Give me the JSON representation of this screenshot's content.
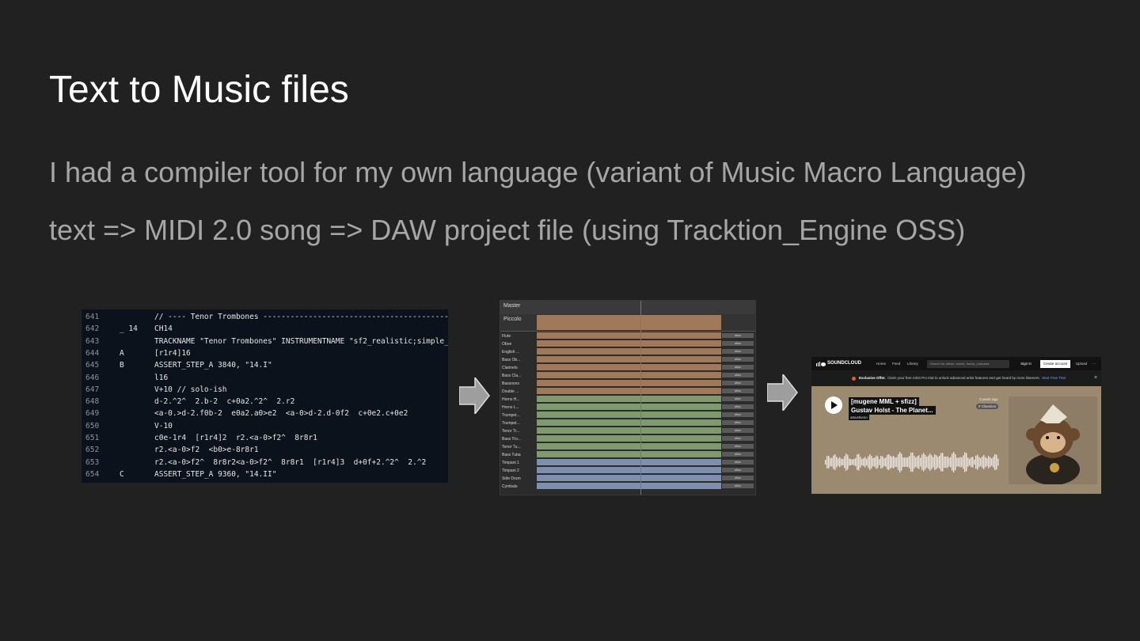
{
  "slide": {
    "title": "Text to Music files",
    "line1": "I had a compiler tool for my own language (variant of Music Macro Language)",
    "line2": "text => MIDI 2.0 song => DAW project file (using Tracktion_Engine OSS)"
  },
  "code": {
    "lines": [
      {
        "n": "641",
        "label": "",
        "text": "// ---- Tenor Trombones -----------------------------------------------------"
      },
      {
        "n": "642",
        "label": "_ 14",
        "text": "CH14"
      },
      {
        "n": "643",
        "label": "",
        "text": "TRACKNAME \"Tenor Trombones\" INSTRUMENTNAME \"sf2_realistic;simple_re"
      },
      {
        "n": "644",
        "label": "A",
        "text": "[r1r4]16"
      },
      {
        "n": "645",
        "label": "B",
        "text": "ASSERT_STEP_A 3840, \"14.I\""
      },
      {
        "n": "646",
        "label": "",
        "text": "l16"
      },
      {
        "n": "647",
        "label": "",
        "text": "V+10 // solo-ish"
      },
      {
        "n": "648",
        "label": "",
        "text": "d-2.^2^  2.b-2  c+0a2.^2^  2.r2"
      },
      {
        "n": "649",
        "label": "",
        "text": "<a-0.>d-2.f0b-2  e0a2.a0>e2  <a-0>d-2.d-0f2  c+0e2.c+0e2"
      },
      {
        "n": "650",
        "label": "",
        "text": "V-10"
      },
      {
        "n": "651",
        "label": "",
        "text": "c0e-1r4  [r1r4]2  r2.<a-0>f2^  8r8r1"
      },
      {
        "n": "652",
        "label": "",
        "text": "r2.<a-0>f2  <b0>e-8r8r1"
      },
      {
        "n": "653",
        "label": "",
        "text": "r2.<a-0>f2^  8r8r2<a-0>f2^  8r8r1  [r1r4]3  d+0f+2.^2^  2.^2"
      },
      {
        "n": "654",
        "label": "C",
        "text": "ASSERT_STEP_A 9360, \"14.II\""
      }
    ]
  },
  "daw": {
    "master_label": "Master",
    "first_track": "Piccolo",
    "control_label": "sfizz",
    "tracks": [
      {
        "name": "Flute",
        "color": "#a0795a"
      },
      {
        "name": "Oboe",
        "color": "#a0795a"
      },
      {
        "name": "English ...",
        "color": "#a0795a"
      },
      {
        "name": "Bass Ob...",
        "color": "#a0795a"
      },
      {
        "name": "Clarinets",
        "color": "#a0795a"
      },
      {
        "name": "Bass Cla...",
        "color": "#a0795a"
      },
      {
        "name": "Bassoons",
        "color": "#a0795a"
      },
      {
        "name": "Double ...",
        "color": "#a0795a"
      },
      {
        "name": "Horns H...",
        "color": "#7f9a6e"
      },
      {
        "name": "Horns L...",
        "color": "#7f9a6e"
      },
      {
        "name": "Trumpet...",
        "color": "#7f9a6e"
      },
      {
        "name": "Trumpet...",
        "color": "#7f9a6e"
      },
      {
        "name": "Tenor Tr...",
        "color": "#7f9a6e"
      },
      {
        "name": "Bass Tro...",
        "color": "#7f9a6e"
      },
      {
        "name": "Tenor Tu...",
        "color": "#7f9a6e"
      },
      {
        "name": "Bass Tuba",
        "color": "#7f9a6e"
      },
      {
        "name": "Timpani 1",
        "color": "#7f8fb0"
      },
      {
        "name": "Timpani 2",
        "color": "#7f8fb0"
      },
      {
        "name": "Side Drum",
        "color": "#7f8fb0"
      },
      {
        "name": "Cymbals",
        "color": "#7f8fb0"
      }
    ]
  },
  "soundcloud": {
    "logo": "SOUNDCLOUD",
    "nav": [
      "Home",
      "Feed",
      "Library"
    ],
    "search_placeholder": "Search for artists, bands, tracks, podcasts",
    "sign_in": "Sign in",
    "create_account": "Create account",
    "upload": "Upload",
    "more": "···",
    "offer_label": "Exclusive Offer.",
    "offer_text": "Claim your free Artist Pro trial to unlock advanced artist features and get heard by more listeners.",
    "offer_link": "Start Free Trial",
    "track_title_1": "[mugene MML + sfizz]",
    "track_title_2": "Gustav Holst - The Planet...",
    "artist": "atsushieno",
    "posted": "3 years ago",
    "genre_tag": "# Classical",
    "close": "×"
  }
}
